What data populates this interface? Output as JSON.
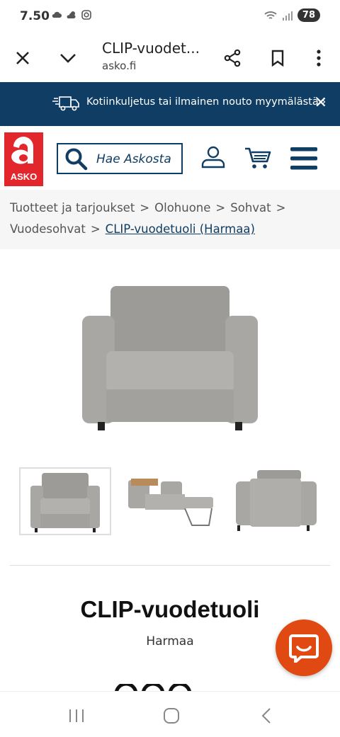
{
  "status": {
    "time": "7.50",
    "battery": "78"
  },
  "browser": {
    "title": "CLIP-vuodet...",
    "url": "asko.fi"
  },
  "promo": {
    "text": "Kotiinkuljetus tai ilmainen nouto myymälästä ›"
  },
  "header": {
    "logo_text": "ASKO",
    "search_placeholder": "Hae Askosta"
  },
  "breadcrumbs": [
    "Tuotteet ja tarjoukset",
    "Olohuone",
    "Sohvat",
    "Vuodesohvat",
    "CLIP-vuodetuoli (Harmaa)"
  ],
  "product": {
    "name": "CLIP-vuodetuoli",
    "variant": "Harmaa"
  },
  "colors": {
    "brand_red": "#e3262b",
    "navy": "#0f3d63",
    "chat_orange": "#e04a12",
    "chair_grey": "#a9a7a3"
  }
}
